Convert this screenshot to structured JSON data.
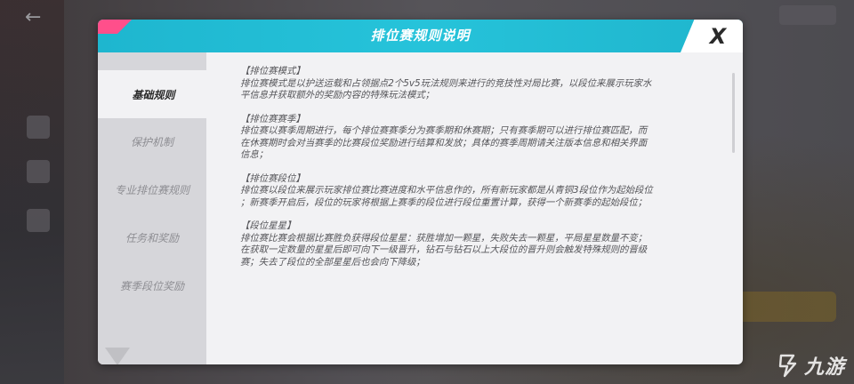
{
  "dialog": {
    "title": "排位赛规则说明",
    "close_label": "X"
  },
  "tabs": [
    {
      "label": "基础规则",
      "active": true
    },
    {
      "label": "保护机制",
      "active": false
    },
    {
      "label": "专业排位赛规则",
      "active": false
    },
    {
      "label": "任务和奖励",
      "active": false
    },
    {
      "label": "赛季段位奖励",
      "active": false
    }
  ],
  "sections": [
    {
      "title": "【排位赛模式】",
      "lines": [
        "排位赛模式是以护送运载和占领据点2个5v5玩法规则来进行的竞技性对局比赛，以段位来展示玩家水",
        "平信息并获取额外的奖励内容的特殊玩法模式；"
      ]
    },
    {
      "title": "【排位赛赛季】",
      "lines": [
        "排位赛以赛季周期进行，每个排位赛赛季分为赛季期和休赛期；只有赛季期可以进行排位赛匹配，而",
        "在休赛期时会对当赛季的比赛段位奖励进行结算和发放；具体的赛季周期请关注版本信息和相关界面",
        "信息；"
      ]
    },
    {
      "title": "【排位赛段位】",
      "lines": [
        "排位赛以段位来展示玩家排位赛比赛进度和水平信息作的，所有新玩家都是从青铜3段位作为起始段位",
        "；新赛季开启后，段位的玩家将根据上赛季的段位进行段位重置计算，获得一个新赛季的起始段位；"
      ]
    },
    {
      "title": "【段位星星】",
      "lines": [
        "排位赛比赛会根据比赛胜负获得段位星星：获胜增加一颗星，失败失去一颗星，平局星星数量不变；",
        "在获取一定数量的星星后即可向下一级晋升，钻石与钻石以上大段位的晋升则会触发特殊规则的晋级",
        "赛；失去了段位的全部星星后也会向下降级；"
      ]
    }
  ],
  "watermark": {
    "text": "九游"
  },
  "colors": {
    "header": "#1eb6cf",
    "accent_pink": "#ff4f8b",
    "panel": "#f2f2f4",
    "tab_bg": "#d6d6da"
  }
}
